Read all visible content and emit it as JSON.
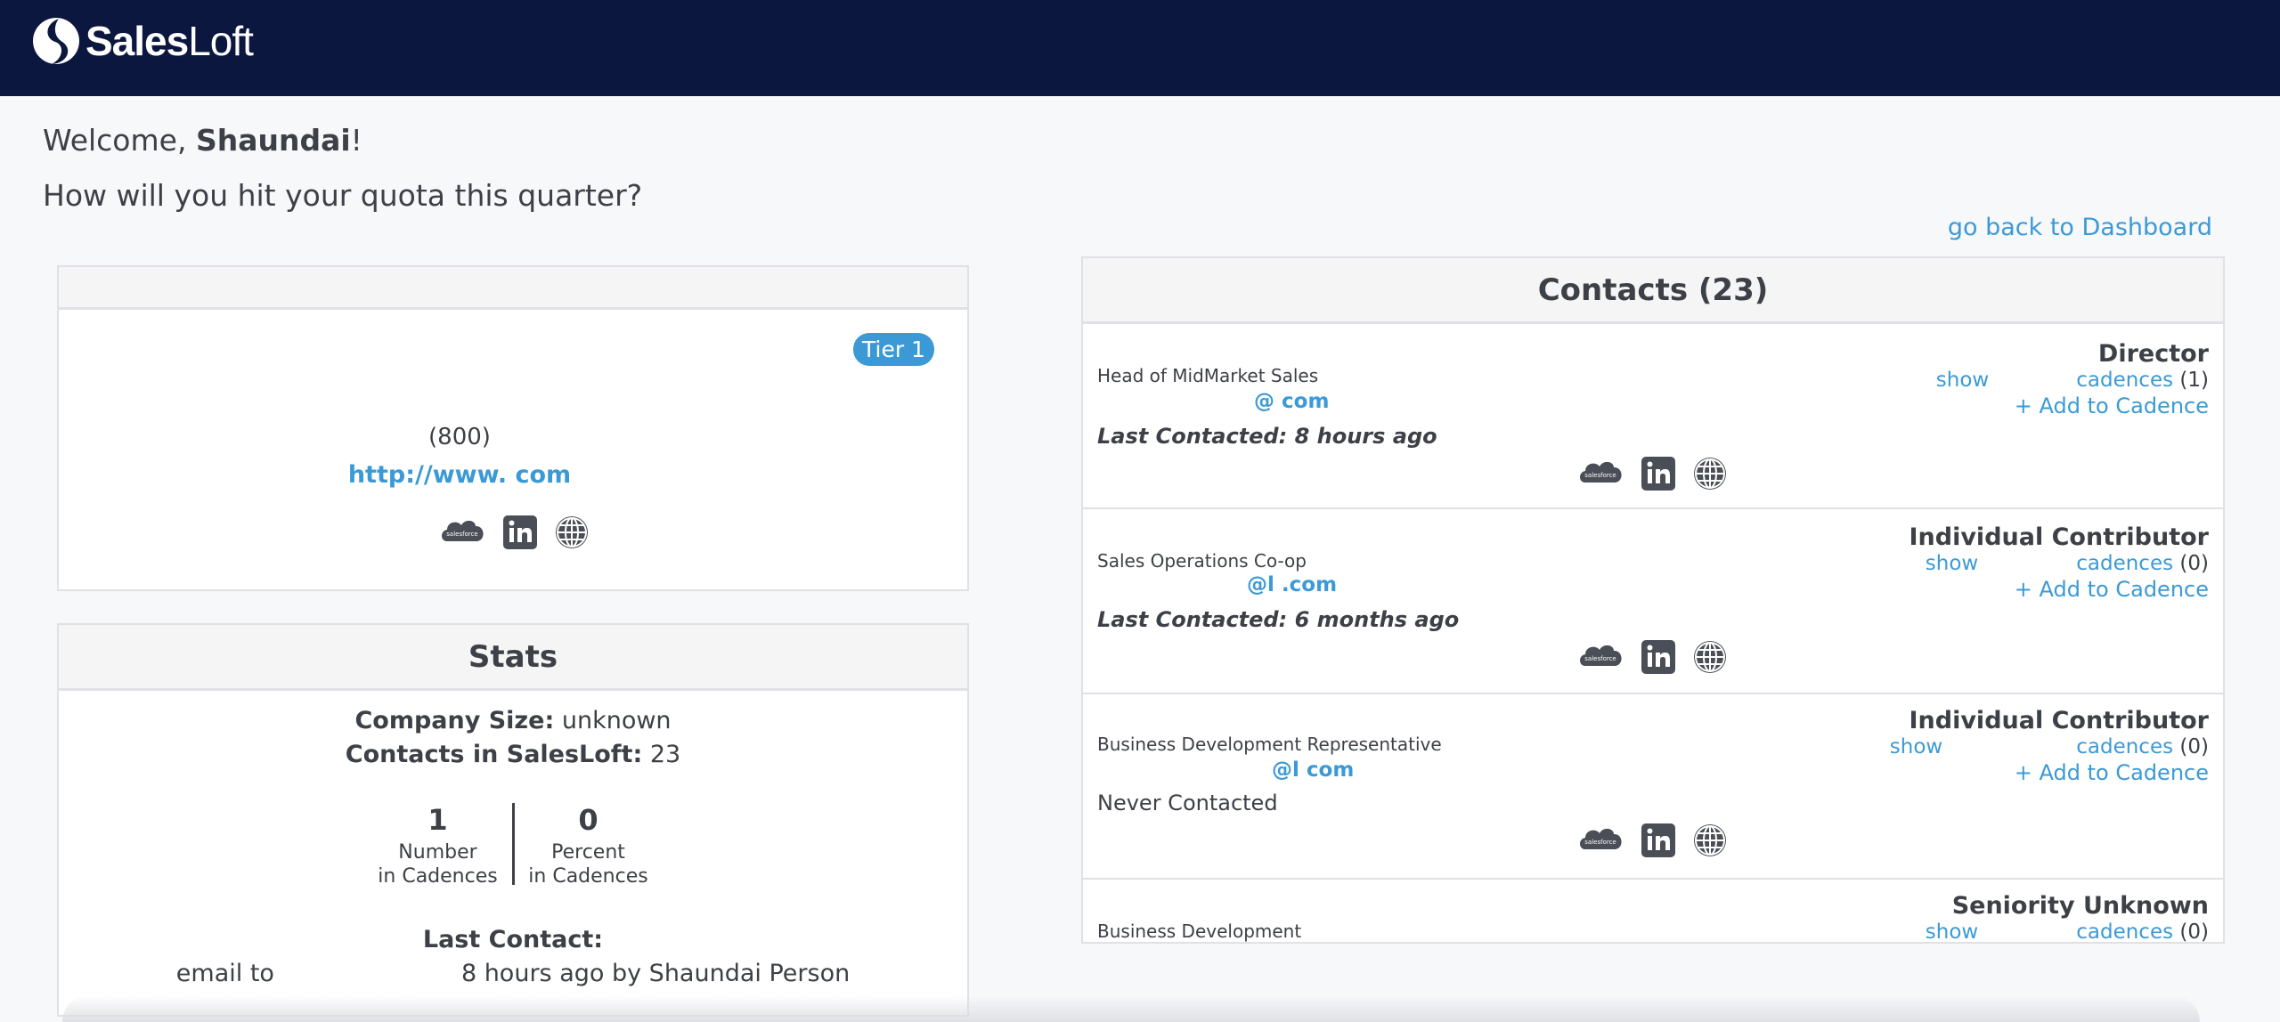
{
  "header": {
    "logo_bold": "Sales",
    "logo_light": "Loft"
  },
  "welcome": {
    "prefix": "Welcome, ",
    "name": "Shaundai",
    "suffix": "!",
    "question": "How will you hit your quota this quarter?"
  },
  "nav": {
    "back_link": "go back to Dashboard"
  },
  "account": {
    "tier": "Tier 1",
    "phone": "(800)",
    "url": "http://www.            com",
    "icons": [
      "salesforce-icon",
      "linkedin-icon",
      "globe-icon"
    ]
  },
  "stats": {
    "title": "Stats",
    "company_size_label": "Company Size:",
    "company_size_value": "unknown",
    "contacts_label": "Contacts in SalesLoft:",
    "contacts_value": "23",
    "number_value": "1",
    "number_label_1": "Number",
    "number_label_2": "in Cadences",
    "percent_value": "0",
    "percent_label_1": "Percent",
    "percent_label_2": "in Cadences",
    "last_contact_label": "Last Contact:",
    "last_contact_prefix": "email to",
    "last_contact_text": "8 hours ago by Shaundai Person"
  },
  "contacts": {
    "title": "Contacts (23)",
    "items": [
      {
        "job_title": "Head of MidMarket Sales",
        "email": "@           com",
        "last_contacted": "Last Contacted: 8 hours ago",
        "seniority": "Director",
        "show": "show",
        "cadences": "cadences",
        "count": "(1)",
        "add": "+ Add to Cadence"
      },
      {
        "job_title": "Sales Operations Co-op",
        "email": "@l         .com",
        "last_contacted": "Last Contacted: 6 months ago",
        "seniority": "Individual Contributor",
        "show": "show",
        "cadences": "cadences",
        "count": "(0)",
        "add": "+ Add to Cadence"
      },
      {
        "job_title": "Business Development Representative",
        "email": "@l        com",
        "last_contacted": "Never Contacted",
        "seniority": "Individual Contributor",
        "show": "show",
        "cadences": "cadences",
        "count": "(0)",
        "add": "+ Add to Cadence"
      },
      {
        "job_title": "Business Development",
        "seniority": "Seniority Unknown",
        "show": "show",
        "cadences": "cadences",
        "count": "(0)"
      }
    ]
  },
  "colors": {
    "topbar": "#0c173f",
    "link": "#3b9ad6",
    "text": "#3d4046"
  }
}
